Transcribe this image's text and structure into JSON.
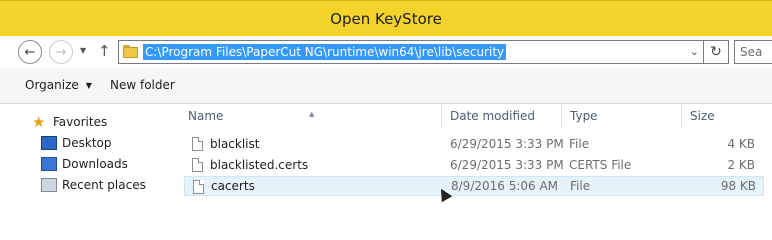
{
  "window": {
    "title": "Open KeyStore"
  },
  "address": {
    "path": "C:\\Program Files\\PaperCut NG\\runtime\\win64\\jre\\lib\\security",
    "search_placeholder": "Sea"
  },
  "nav_buttons": {
    "back_icon": "back-arrow-icon",
    "forward_icon": "forward-arrow-icon",
    "up_icon": "up-arrow-icon",
    "refresh_icon": "refresh-icon"
  },
  "toolbar": {
    "organize": "Organize",
    "new_folder": "New folder"
  },
  "navigation": {
    "favorites": "Favorites",
    "items": [
      {
        "label": "Desktop",
        "icon": "desktop-icon"
      },
      {
        "label": "Downloads",
        "icon": "downloads-icon"
      },
      {
        "label": "Recent places",
        "icon": "recent-places-icon"
      }
    ]
  },
  "columns": {
    "name": "Name",
    "date": "Date modified",
    "type": "Type",
    "size": "Size"
  },
  "files": [
    {
      "name": "blacklist",
      "date": "6/29/2015 3:33 PM",
      "type": "File",
      "size": "4 KB"
    },
    {
      "name": "blacklisted.certs",
      "date": "6/29/2015 3:33 PM",
      "type": "CERTS File",
      "size": "2 KB"
    },
    {
      "name": "cacerts",
      "date": "8/9/2016 5:06 AM",
      "type": "File",
      "size": "98 KB"
    }
  ],
  "colors": {
    "titlebar": "#f4d42a",
    "selection": "#3399ff",
    "hover_row": "#e5f3fb",
    "header_text": "#4c607a"
  }
}
